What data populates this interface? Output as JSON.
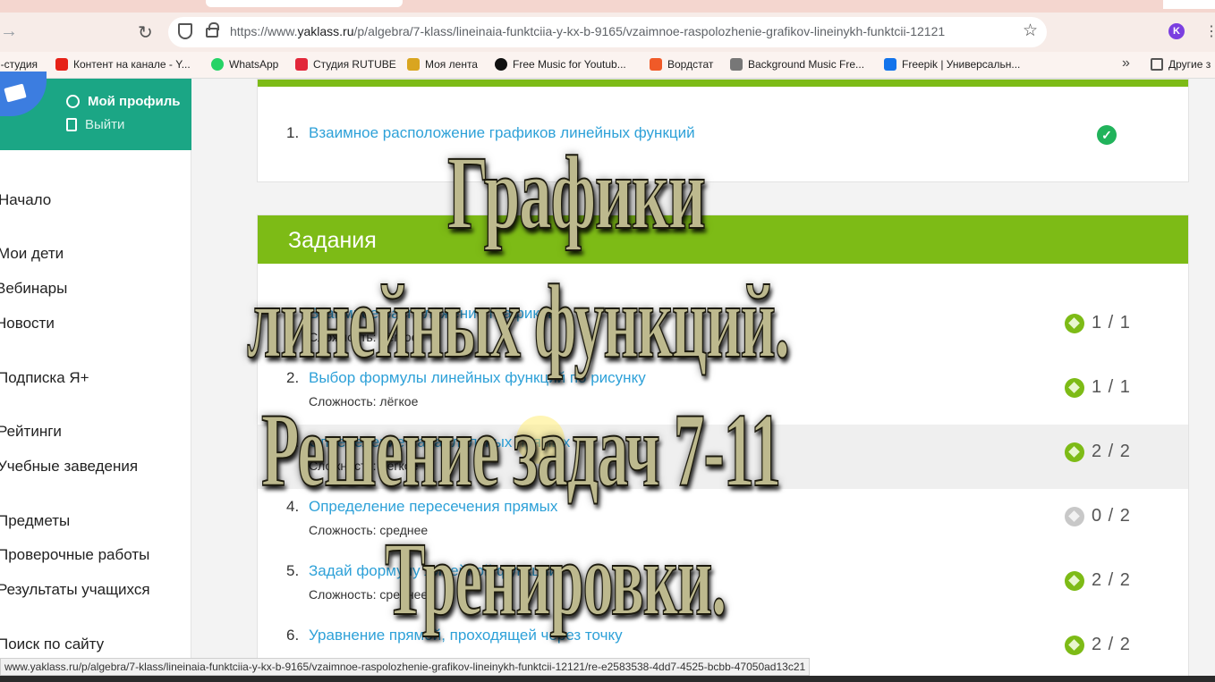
{
  "browser": {
    "url_prefix": "https://www.",
    "url_domain": "yaklass.ru",
    "url_path": "/p/algebra/7-klass/lineinaia-funktciia-y-kx-b-9165/vzaimnoe-raspolozhenie-grafikov-lineinykh-funktcii-12121",
    "profile_letter": "K",
    "bookmarks": [
      {
        "label": "н-студия",
        "color": "#ffffff"
      },
      {
        "label": "Контент на канале - Y...",
        "color": "#e62117"
      },
      {
        "label": "WhatsApp",
        "color": "#25d366"
      },
      {
        "label": "Студия RUTUBE",
        "color": "#e2273a"
      },
      {
        "label": "Моя лента",
        "color": "#d9a520"
      },
      {
        "label": "Free Music for Youtub...",
        "color": "#111111"
      },
      {
        "label": "Вордстат",
        "color": "#f05a28"
      },
      {
        "label": "Background Music Fre...",
        "color": "#555555"
      },
      {
        "label": "Freepik | Универсальн...",
        "color": "#1273eb"
      },
      {
        "label": "Другие з",
        "color": "#666666"
      }
    ]
  },
  "profile": {
    "my_profile": "Мой профиль",
    "logout": "Выйти"
  },
  "nav": [
    "Начало",
    "Мои дети",
    "Вебинары",
    "Новости",
    "Подписка Я+",
    "Рейтинги",
    "Учебные заведения",
    "Предметы",
    "Проверочные работы",
    "Результаты учащихся",
    "Поиск по сайту"
  ],
  "theory": {
    "num": "1.",
    "title": "Взаимное расположение графиков линейных функций"
  },
  "tasks": {
    "heading": "Задания",
    "items": [
      {
        "num": "",
        "title": "Взаимное расположение графиков",
        "difficulty": "Сложность: лёгкое",
        "score": "1 / 1",
        "done": true
      },
      {
        "num": "2.",
        "title": "Выбор формулы линейных функций по рисунку",
        "difficulty": "Сложность: лёгкое",
        "score": "1 / 1",
        "done": true
      },
      {
        "num": "3.",
        "title": "Определение параллельных прямых",
        "difficulty": "Сложность: лёгкое",
        "score": "2 / 2",
        "done": true
      },
      {
        "num": "4.",
        "title": "Определение пересечения прямых",
        "difficulty": "Сложность: среднее",
        "score": "0 / 2",
        "done": false
      },
      {
        "num": "5.",
        "title": "Задай формулу линейной функции",
        "difficulty": "Сложность: среднее",
        "score": "2 / 2",
        "done": true
      },
      {
        "num": "6.",
        "title": "Уравнение прямой, проходящей через точку",
        "difficulty": "",
        "score": "2 / 2",
        "done": true
      }
    ]
  },
  "status_url": "www.yaklass.ru/p/algebra/7-klass/lineinaia-funktciia-y-kx-b-9165/vzaimnoe-raspolozhenie-grafikov-lineinykh-funktcii-12121/re-e2583538-4dd7-4525-bcbb-47050ad13c21",
  "overlay": {
    "line1": "Графики",
    "line2": "линейных функций.",
    "line3": "Решение задач 7-11",
    "line4": "Тренировки."
  }
}
